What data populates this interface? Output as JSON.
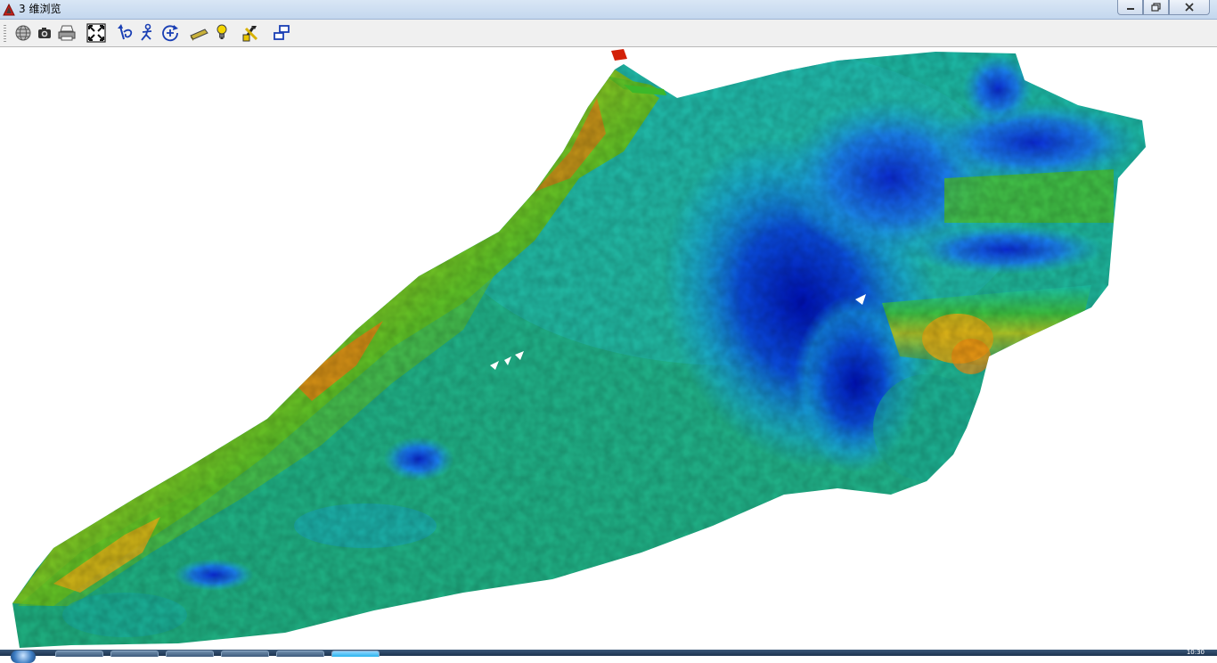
{
  "window": {
    "title": "3 维浏览",
    "icon": "red-triangle-app-icon",
    "controls": [
      "minimize-icon",
      "restore-icon",
      "close-icon"
    ]
  },
  "toolbar": {
    "buttons": [
      {
        "name": "globe-button",
        "icon": "globe-icon"
      },
      {
        "name": "camera-button",
        "icon": "camera-icon"
      },
      {
        "name": "print-button",
        "icon": "printer-icon"
      },
      {
        "name": "full-extent-button",
        "icon": "full-extent-icon"
      },
      {
        "name": "rotate-button",
        "icon": "rotate-icon"
      },
      {
        "name": "walk-button",
        "icon": "walk-icon"
      },
      {
        "name": "zoom-button",
        "icon": "zoom-target-icon"
      },
      {
        "name": "surface-button",
        "icon": "surface-plate-icon"
      },
      {
        "name": "light-button",
        "icon": "lightbulb-icon"
      },
      {
        "name": "tools-button",
        "icon": "tools-icon"
      },
      {
        "name": "layout-button",
        "icon": "window-layout-icon"
      }
    ]
  },
  "viewport": {
    "content": "3d-terrain-surface",
    "colormap": [
      "#0018b8",
      "#0a6ee0",
      "#18b8d0",
      "#20b07a",
      "#4cbe2a",
      "#c6c41a",
      "#ee8a10",
      "#d22008"
    ]
  },
  "taskbar": {
    "clock": "10:30",
    "items": 6
  }
}
